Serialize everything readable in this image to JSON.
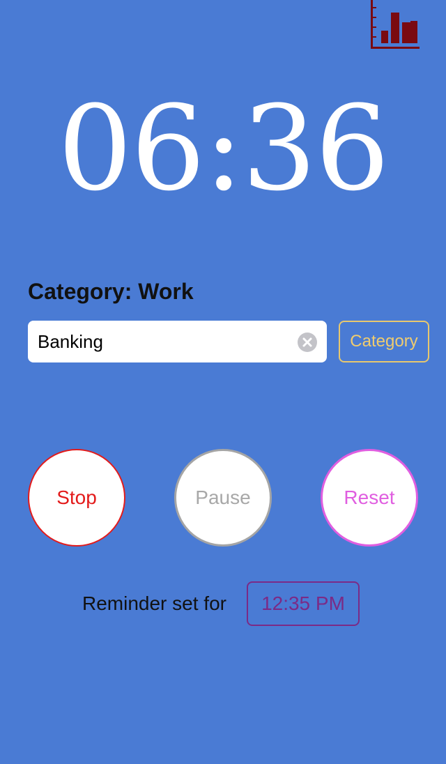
{
  "colors": {
    "background": "#4a7bd4",
    "stats_icon": "#7a0a10",
    "category_accent": "#e8c86e",
    "stop": "#e31b1b",
    "pause": "#a5a5a5",
    "reset": "#e05ee0",
    "reminder": "#7b2a86"
  },
  "header": {
    "stats_icon": "bar-chart-icon"
  },
  "timer": {
    "display": "06:36"
  },
  "category": {
    "title": "Category: Work",
    "task_value": "Banking",
    "clear_icon": "clear-circle-icon",
    "button_label": "Category"
  },
  "controls": {
    "stop_label": "Stop",
    "pause_label": "Pause",
    "reset_label": "Reset"
  },
  "reminder": {
    "label": "Reminder set for",
    "time": "12:35 PM"
  }
}
